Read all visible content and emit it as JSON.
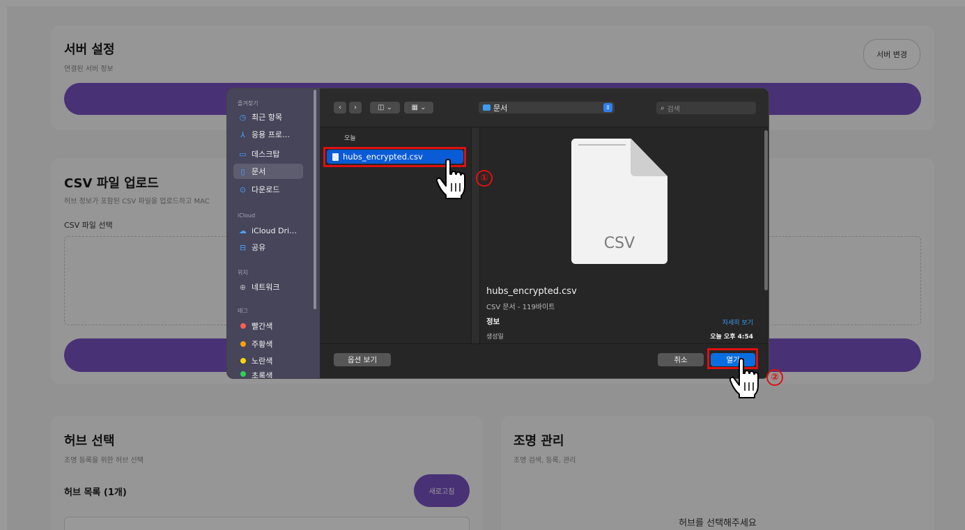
{
  "server": {
    "title": "서버 설정",
    "subtitle": "연결된 서버 정보",
    "change_button": "서버 변경"
  },
  "csv": {
    "title": "CSV 파일 업로드",
    "subtitle": "허브 정보가 포함된 CSV 파일을 업로드하고 MAC",
    "select_label": "CSV 파일 선택"
  },
  "hub": {
    "title": "허브 선택",
    "subtitle": "조명 등록을 위한 허브 선택",
    "list_label": "허브 목록 (1개)",
    "refresh_button": "새로고침"
  },
  "light": {
    "title": "조명 관리",
    "subtitle": "조명 검색, 등록, 관리",
    "empty_message": "허브를 선택해주세요"
  },
  "dialog": {
    "sidebar": {
      "favorites_header": "즐겨찾기",
      "favorites": [
        {
          "icon": "clock-icon",
          "glyph": "◷",
          "label": "최근 항목"
        },
        {
          "icon": "applications-icon",
          "glyph": "⅄",
          "label": "응용 프로…"
        },
        {
          "icon": "desktop-icon",
          "glyph": "▭",
          "label": "데스크탑"
        },
        {
          "icon": "document-icon",
          "glyph": "▯",
          "label": "문서"
        },
        {
          "icon": "download-icon",
          "glyph": "⊙",
          "label": "다운로드"
        }
      ],
      "icloud_header": "iCloud",
      "icloud": [
        {
          "icon": "cloud-icon",
          "glyph": "☁",
          "label": "iCloud Dri…"
        },
        {
          "icon": "shared-folder-icon",
          "glyph": "⊟",
          "label": "공유"
        }
      ],
      "locations_header": "위치",
      "locations": [
        {
          "icon": "network-icon",
          "glyph": "⊕",
          "label": "네트워크"
        }
      ],
      "tags_header": "태그",
      "tags": [
        {
          "color": "#ff5f57",
          "label": "빨간색"
        },
        {
          "color": "#ff9f0a",
          "label": "주황색"
        },
        {
          "color": "#ffd60a",
          "label": "노란색"
        },
        {
          "color": "#30d158",
          "label": "초록색"
        }
      ]
    },
    "toolbar": {
      "location": "문서",
      "search_placeholder": "검색"
    },
    "list": {
      "section": "오늘",
      "selected_file": "hubs_encrypted.csv"
    },
    "preview": {
      "file_type_badge": "CSV",
      "name": "hubs_encrypted.csv",
      "meta": "CSV 문서 - 119바이트",
      "info_label": "정보",
      "more_link": "자세히 보기",
      "created_label": "생성일",
      "created_value": "오늘 오후 4:54"
    },
    "footer": {
      "options_button": "옵션 보기",
      "cancel_button": "취소",
      "open_button": "열기"
    }
  },
  "annotations": {
    "step1": "①",
    "step2": "②"
  }
}
